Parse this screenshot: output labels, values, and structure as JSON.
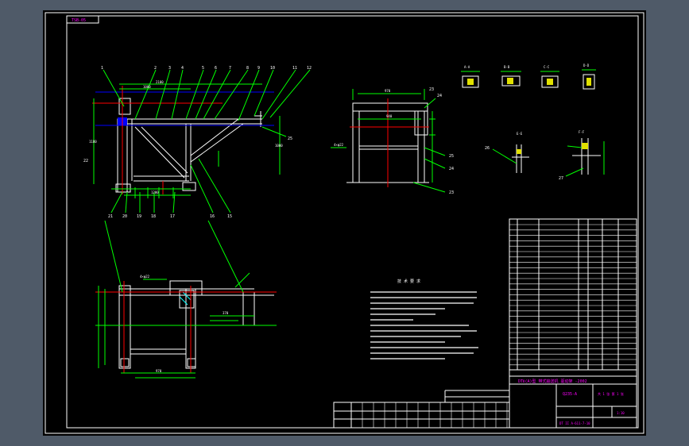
{
  "colors": {
    "background": "#000000",
    "frame": "#ffffff",
    "outline": "#ffffff",
    "dimension": "#00ff00",
    "text": "#ffffff",
    "table_text": "#ff00ff",
    "hidden": "#0000ff",
    "center": "#ff0000",
    "hatch": "#00ffff",
    "section_fill": "#e0e000"
  },
  "drawing": {
    "corner_tag": "TSB-05",
    "section_labels": [
      "A-A",
      "B-B",
      "C-C",
      "D-D",
      "E-E",
      "F-F"
    ],
    "balloons_front": [
      "1",
      "2",
      "3",
      "4",
      "5",
      "6",
      "7",
      "8",
      "9",
      "10",
      "11",
      "12"
    ],
    "balloons_bottom": [
      "21",
      "20",
      "19",
      "18",
      "17",
      "16",
      "15"
    ],
    "balloons_side": [
      "23",
      "24",
      "25"
    ],
    "notes_title": "技 术 要 求",
    "title_block": {
      "drawing_name": "DTⅡ(A)型 带式输送机 驱动架 -2002",
      "material": "Q235-A",
      "scale": "1:10",
      "code": "DT II A-611-7-10",
      "sheet": "共 1 张 第 1 张"
    }
  }
}
